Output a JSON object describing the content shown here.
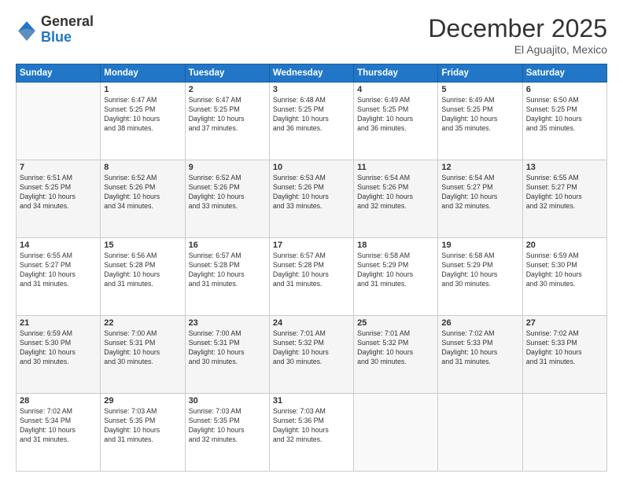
{
  "header": {
    "logo_general": "General",
    "logo_blue": "Blue",
    "month_title": "December 2025",
    "location": "El Aguajito, Mexico"
  },
  "days_of_week": [
    "Sunday",
    "Monday",
    "Tuesday",
    "Wednesday",
    "Thursday",
    "Friday",
    "Saturday"
  ],
  "weeks": [
    [
      {
        "day": "",
        "info": ""
      },
      {
        "day": "1",
        "info": "Sunrise: 6:47 AM\nSunset: 5:25 PM\nDaylight: 10 hours\nand 38 minutes."
      },
      {
        "day": "2",
        "info": "Sunrise: 6:47 AM\nSunset: 5:25 PM\nDaylight: 10 hours\nand 37 minutes."
      },
      {
        "day": "3",
        "info": "Sunrise: 6:48 AM\nSunset: 5:25 PM\nDaylight: 10 hours\nand 36 minutes."
      },
      {
        "day": "4",
        "info": "Sunrise: 6:49 AM\nSunset: 5:25 PM\nDaylight: 10 hours\nand 36 minutes."
      },
      {
        "day": "5",
        "info": "Sunrise: 6:49 AM\nSunset: 5:25 PM\nDaylight: 10 hours\nand 35 minutes."
      },
      {
        "day": "6",
        "info": "Sunrise: 6:50 AM\nSunset: 5:25 PM\nDaylight: 10 hours\nand 35 minutes."
      }
    ],
    [
      {
        "day": "7",
        "info": "Sunrise: 6:51 AM\nSunset: 5:25 PM\nDaylight: 10 hours\nand 34 minutes."
      },
      {
        "day": "8",
        "info": "Sunrise: 6:52 AM\nSunset: 5:26 PM\nDaylight: 10 hours\nand 34 minutes."
      },
      {
        "day": "9",
        "info": "Sunrise: 6:52 AM\nSunset: 5:26 PM\nDaylight: 10 hours\nand 33 minutes."
      },
      {
        "day": "10",
        "info": "Sunrise: 6:53 AM\nSunset: 5:26 PM\nDaylight: 10 hours\nand 33 minutes."
      },
      {
        "day": "11",
        "info": "Sunrise: 6:54 AM\nSunset: 5:26 PM\nDaylight: 10 hours\nand 32 minutes."
      },
      {
        "day": "12",
        "info": "Sunrise: 6:54 AM\nSunset: 5:27 PM\nDaylight: 10 hours\nand 32 minutes."
      },
      {
        "day": "13",
        "info": "Sunrise: 6:55 AM\nSunset: 5:27 PM\nDaylight: 10 hours\nand 32 minutes."
      }
    ],
    [
      {
        "day": "14",
        "info": "Sunrise: 6:55 AM\nSunset: 5:27 PM\nDaylight: 10 hours\nand 31 minutes."
      },
      {
        "day": "15",
        "info": "Sunrise: 6:56 AM\nSunset: 5:28 PM\nDaylight: 10 hours\nand 31 minutes."
      },
      {
        "day": "16",
        "info": "Sunrise: 6:57 AM\nSunset: 5:28 PM\nDaylight: 10 hours\nand 31 minutes."
      },
      {
        "day": "17",
        "info": "Sunrise: 6:57 AM\nSunset: 5:28 PM\nDaylight: 10 hours\nand 31 minutes."
      },
      {
        "day": "18",
        "info": "Sunrise: 6:58 AM\nSunset: 5:29 PM\nDaylight: 10 hours\nand 31 minutes."
      },
      {
        "day": "19",
        "info": "Sunrise: 6:58 AM\nSunset: 5:29 PM\nDaylight: 10 hours\nand 30 minutes."
      },
      {
        "day": "20",
        "info": "Sunrise: 6:59 AM\nSunset: 5:30 PM\nDaylight: 10 hours\nand 30 minutes."
      }
    ],
    [
      {
        "day": "21",
        "info": "Sunrise: 6:59 AM\nSunset: 5:30 PM\nDaylight: 10 hours\nand 30 minutes."
      },
      {
        "day": "22",
        "info": "Sunrise: 7:00 AM\nSunset: 5:31 PM\nDaylight: 10 hours\nand 30 minutes."
      },
      {
        "day": "23",
        "info": "Sunrise: 7:00 AM\nSunset: 5:31 PM\nDaylight: 10 hours\nand 30 minutes."
      },
      {
        "day": "24",
        "info": "Sunrise: 7:01 AM\nSunset: 5:32 PM\nDaylight: 10 hours\nand 30 minutes."
      },
      {
        "day": "25",
        "info": "Sunrise: 7:01 AM\nSunset: 5:32 PM\nDaylight: 10 hours\nand 30 minutes."
      },
      {
        "day": "26",
        "info": "Sunrise: 7:02 AM\nSunset: 5:33 PM\nDaylight: 10 hours\nand 31 minutes."
      },
      {
        "day": "27",
        "info": "Sunrise: 7:02 AM\nSunset: 5:33 PM\nDaylight: 10 hours\nand 31 minutes."
      }
    ],
    [
      {
        "day": "28",
        "info": "Sunrise: 7:02 AM\nSunset: 5:34 PM\nDaylight: 10 hours\nand 31 minutes."
      },
      {
        "day": "29",
        "info": "Sunrise: 7:03 AM\nSunset: 5:35 PM\nDaylight: 10 hours\nand 31 minutes."
      },
      {
        "day": "30",
        "info": "Sunrise: 7:03 AM\nSunset: 5:35 PM\nDaylight: 10 hours\nand 32 minutes."
      },
      {
        "day": "31",
        "info": "Sunrise: 7:03 AM\nSunset: 5:36 PM\nDaylight: 10 hours\nand 32 minutes."
      },
      {
        "day": "",
        "info": ""
      },
      {
        "day": "",
        "info": ""
      },
      {
        "day": "",
        "info": ""
      }
    ]
  ]
}
